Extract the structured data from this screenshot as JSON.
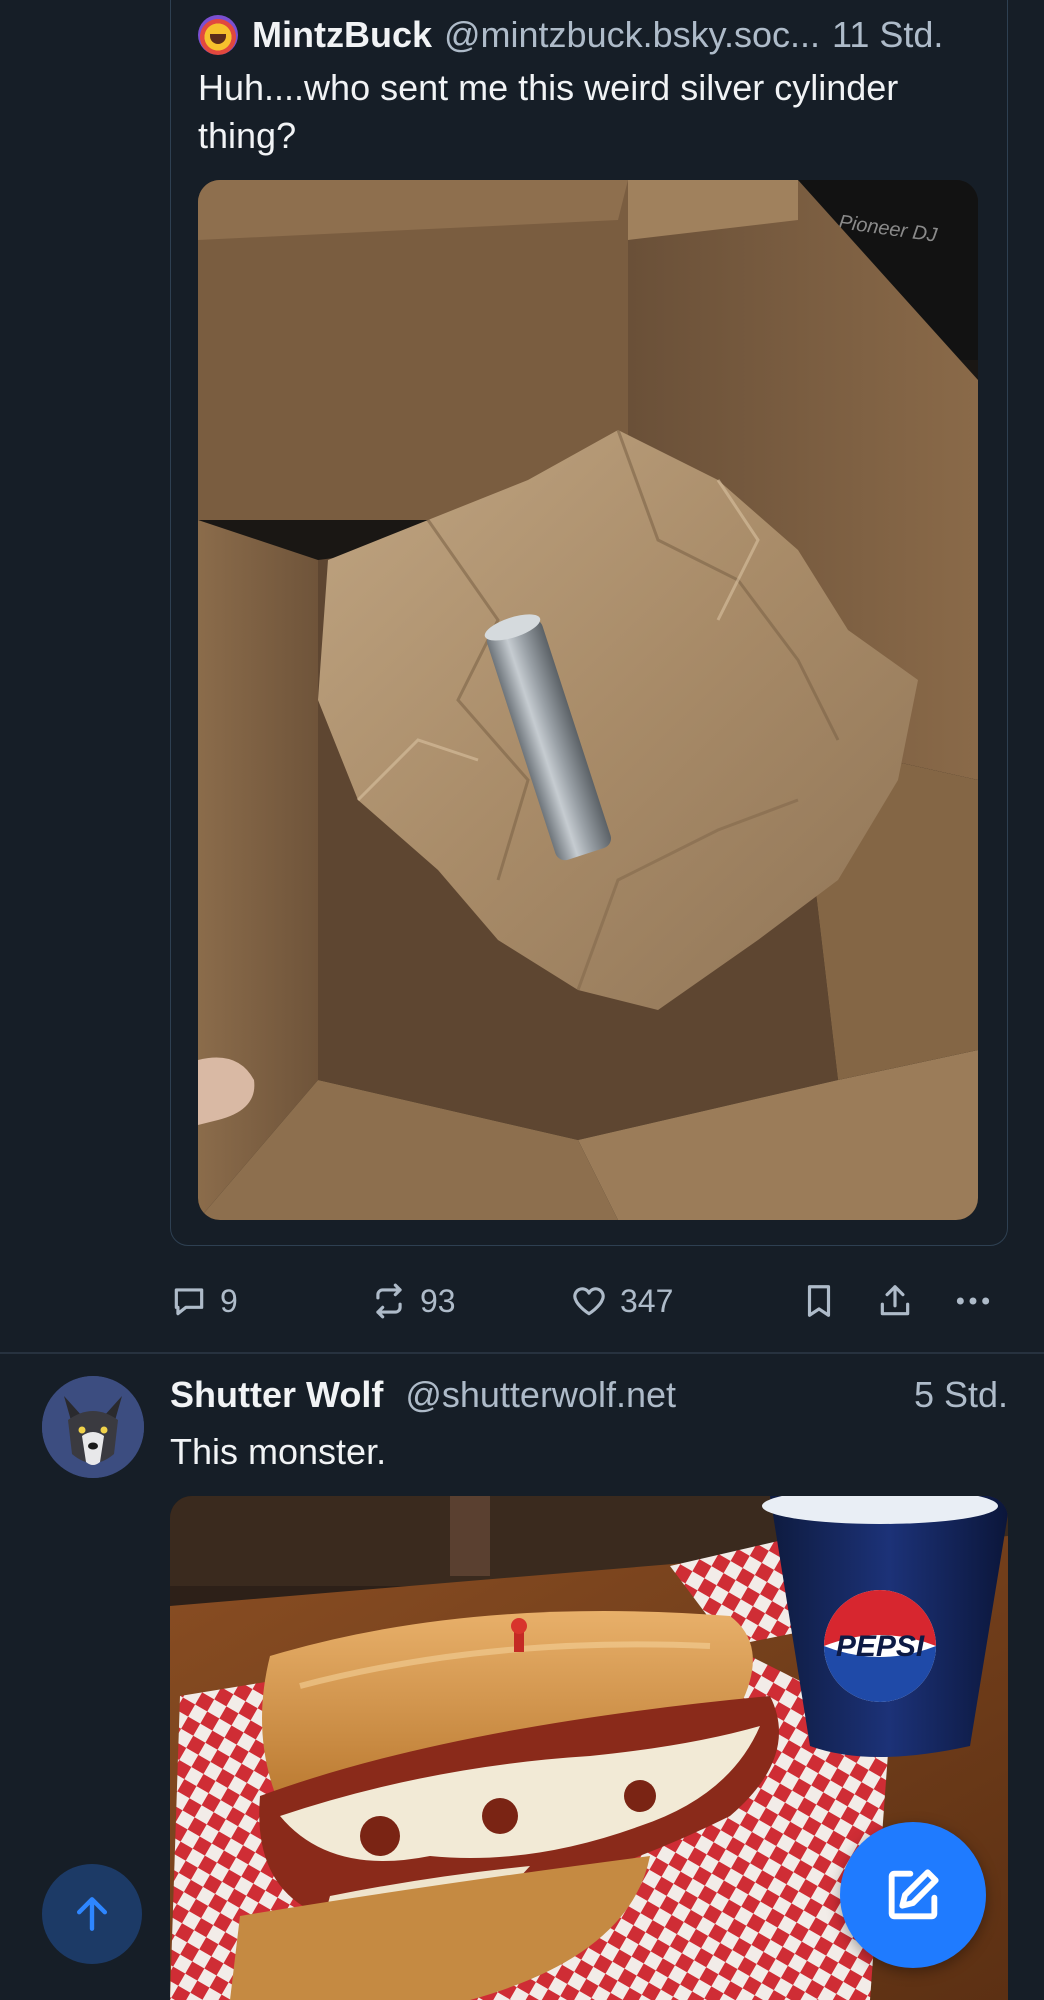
{
  "colors": {
    "background": "#161e27",
    "text_primary": "#f1f3f5",
    "text_secondary": "#aebbc9",
    "divider": "#27323f",
    "accent": "#1f7bff",
    "scroll_button": "#1c3a66"
  },
  "quote_post": {
    "author_name": "MintzBuck",
    "handle": "@mintzbuck.bsky.soc...",
    "time": "11 Std.",
    "text": "Huh....who sent me this weird silver cylinder thing?",
    "image_icon": "photo-cardboard-box-with-silver-cylinder",
    "image_brand_text": "Pioneer DJ"
  },
  "actions": {
    "reply_count": "9",
    "repost_count": "93",
    "like_count": "347",
    "icons": [
      "reply-icon",
      "repost-icon",
      "like-icon",
      "bookmark-icon",
      "share-icon",
      "more-icon"
    ]
  },
  "post2": {
    "author_name": "Shutter Wolf",
    "handle": "@shutterwolf.net",
    "time": "5 Std.",
    "text": "This monster.",
    "image_icon": "photo-meatball-sub-and-pepsi-cup",
    "image_brand_text": "PEPSI"
  },
  "floating": {
    "scroll_top_icon": "arrow-up-icon",
    "compose_icon": "compose-icon"
  }
}
